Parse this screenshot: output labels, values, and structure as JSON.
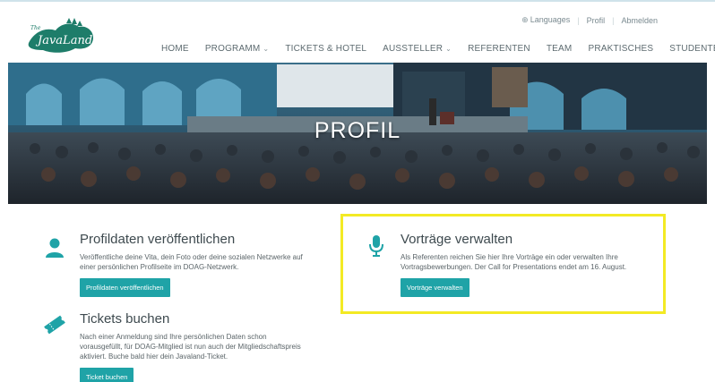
{
  "header": {
    "logo_alt": "JavaLand",
    "utility": {
      "languages": "Languages",
      "profile": "Profil",
      "logout": "Abmelden"
    },
    "nav": [
      {
        "label": "HOME",
        "dropdown": false
      },
      {
        "label": "PROGRAMM",
        "dropdown": true
      },
      {
        "label": "TICKETS & HOTEL",
        "dropdown": false
      },
      {
        "label": "AUSSTELLER",
        "dropdown": true
      },
      {
        "label": "REFERENTEN",
        "dropdown": false
      },
      {
        "label": "TEAM",
        "dropdown": false
      },
      {
        "label": "PRAKTISCHES",
        "dropdown": false
      },
      {
        "label": "STUDENTEN",
        "dropdown": false
      }
    ]
  },
  "hero": {
    "title": "PROFIL"
  },
  "sections": {
    "profile": {
      "title": "Profildaten veröffentlichen",
      "text_lines": [
        "Veröffentliche deine Vita, dein Foto oder deine sozialen Netzwerke auf",
        "einer persönlichen Profilseite im DOAG-Netzwerk."
      ],
      "button": "Profildaten veröffentlichen"
    },
    "talks": {
      "title": "Vorträge verwalten",
      "text_lines": [
        "Als Referenten reichen Sie hier Ihre Vorträge ein oder verwalten Ihre",
        "Vortragsbewerbungen. Der Call for Presentations endet am 16. August."
      ],
      "button": "Vorträge verwalten"
    },
    "tickets": {
      "title": "Tickets buchen",
      "text_lines": [
        "Nach einer Anmeldung sind Ihre persönlichen Daten schon",
        "vorausgefüllt, für DOAG-Mitglied ist nun auch der Mitgliedschaftspreis",
        "aktiviert. Buche bald hier dein Javaland-Ticket."
      ],
      "button": "Ticket buchen"
    }
  },
  "colors": {
    "accent": "#1fa3a7",
    "highlight": "#f3ea24",
    "logo_green": "#1e7d6a"
  }
}
